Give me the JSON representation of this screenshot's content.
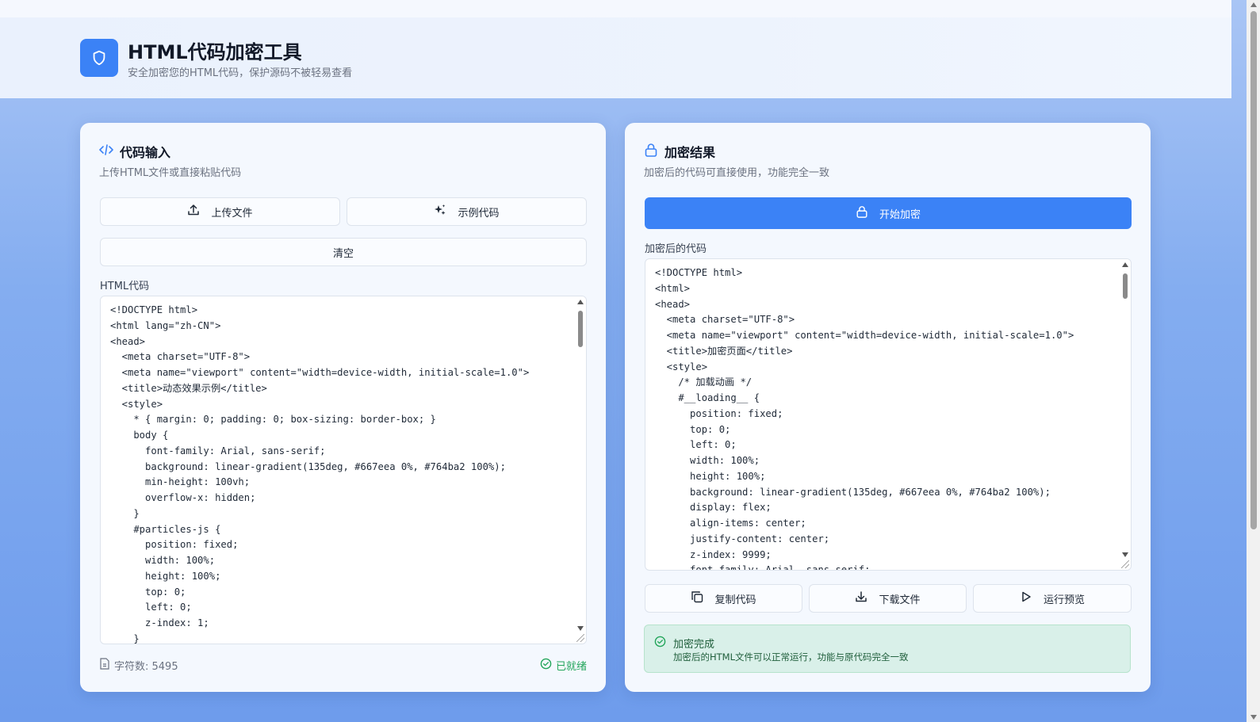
{
  "header": {
    "title": "HTML代码加密工具",
    "subtitle": "安全加密您的HTML代码，保护源码不被轻易查看",
    "logo_icon": "shield-icon"
  },
  "input_panel": {
    "title": "代码输入",
    "subtitle": "上传HTML文件或直接粘贴代码",
    "upload_label": "上传文件",
    "sample_label": "示例代码",
    "clear_label": "清空",
    "field_label": "HTML代码",
    "code": "<!DOCTYPE html>\n<html lang=\"zh-CN\">\n<head>\n  <meta charset=\"UTF-8\">\n  <meta name=\"viewport\" content=\"width=device-width, initial-scale=1.0\">\n  <title>动态效果示例</title>\n  <style>\n    * { margin: 0; padding: 0; box-sizing: border-box; }\n    body {\n      font-family: Arial, sans-serif;\n      background: linear-gradient(135deg, #667eea 0%, #764ba2 100%);\n      min-height: 100vh;\n      overflow-x: hidden;\n    }\n    #particles-js {\n      position: fixed;\n      width: 100%;\n      height: 100%;\n      top: 0;\n      left: 0;\n      z-index: 1;\n    }",
    "char_count": "字符数: 5495",
    "status": "已就绪"
  },
  "output_panel": {
    "title": "加密结果",
    "subtitle": "加密后的代码可直接使用，功能完全一致",
    "encrypt_label": "开始加密",
    "field_label": "加密后的代码",
    "code": "<!DOCTYPE html>\n<html>\n<head>\n  <meta charset=\"UTF-8\">\n  <meta name=\"viewport\" content=\"width=device-width, initial-scale=1.0\">\n  <title>加密页面</title>\n  <style>\n    /* 加载动画 */\n    #__loading__ {\n      position: fixed;\n      top: 0;\n      left: 0;\n      width: 100%;\n      height: 100%;\n      background: linear-gradient(135deg, #667eea 0%, #764ba2 100%);\n      display: flex;\n      align-items: center;\n      justify-content: center;\n      z-index: 9999;\n      font-family: Arial, sans-serif;",
    "copy_label": "复制代码",
    "download_label": "下载文件",
    "preview_label": "运行预览",
    "success_title": "加密完成",
    "success_message": "加密后的HTML文件可以正常运行，功能与原代码完全一致"
  },
  "colors": {
    "accent": "#3b82f6",
    "success": "#22a55a",
    "success_bg": "#d9f0e9"
  }
}
